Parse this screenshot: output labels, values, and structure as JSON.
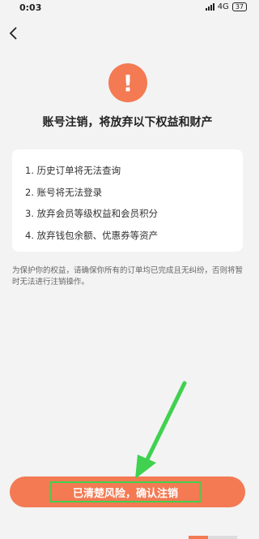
{
  "status_bar": {
    "time": "0:03",
    "network": "4G",
    "battery": "37"
  },
  "page": {
    "headline": "账号注销，将放弃以下权益和财产",
    "items": [
      "1. 历史订单将无法查询",
      "2. 账号将无法登录",
      "3. 放弃会员等级权益和会员积分",
      "4. 放弃钱包余额、优惠券等资产"
    ],
    "notice": "为保护你的权益，请确保你所有的订单均已完成且无纠纷，否则将暂时无法进行注销操作。",
    "confirm_label": "已清楚风险，确认注销"
  },
  "colors": {
    "accent": "#f37a53",
    "highlight": "#3fd14f",
    "background": "#f3f3f3"
  },
  "icons": {
    "back": "chevron-left-icon",
    "warning": "exclamation-icon"
  }
}
